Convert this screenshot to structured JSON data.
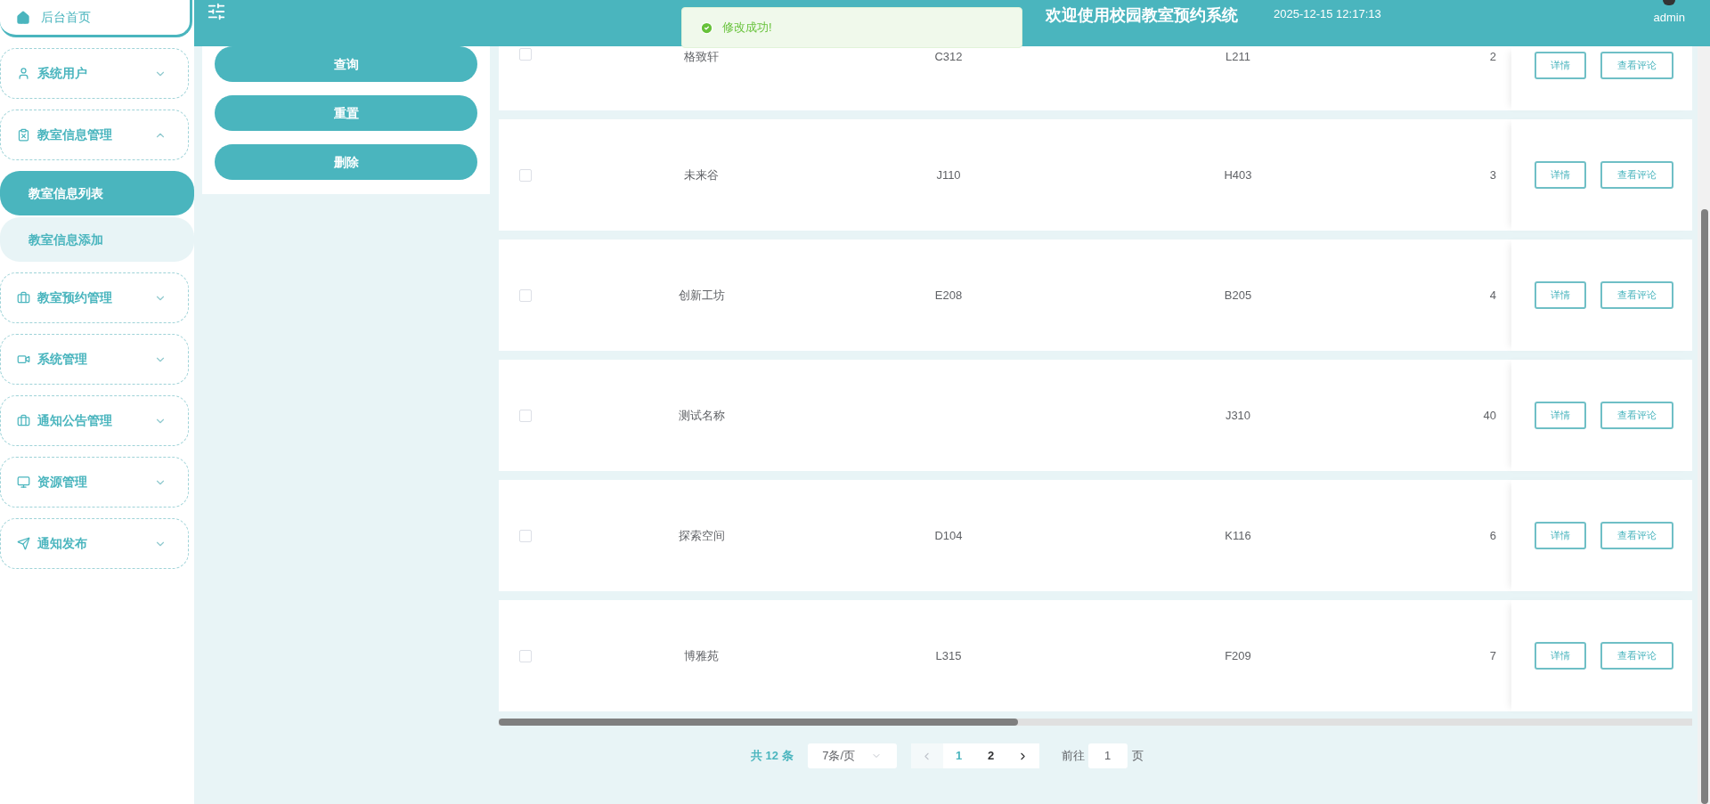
{
  "sidebar": {
    "items": [
      {
        "kind": "link",
        "label": "后台首页",
        "selected": true
      },
      {
        "kind": "group",
        "label": "系统用户",
        "expanded": false
      },
      {
        "kind": "group",
        "label": "教室信息管理",
        "expanded": true,
        "children": [
          {
            "label": "教室信息列表",
            "selected": true
          },
          {
            "label": "教室信息添加",
            "selected": false
          }
        ]
      },
      {
        "kind": "group",
        "label": "教室预约管理",
        "expanded": false
      },
      {
        "kind": "group",
        "label": "系统管理",
        "expanded": false
      },
      {
        "kind": "group",
        "label": "通知公告管理",
        "expanded": false
      },
      {
        "kind": "group",
        "label": "资源管理",
        "expanded": false
      },
      {
        "kind": "group",
        "label": "通知发布",
        "expanded": false
      }
    ]
  },
  "header": {
    "title": "欢迎使用校园教室预约系统",
    "datetime": "2025-12-15 12:17:13",
    "user": "admin"
  },
  "toast": {
    "kind": "success",
    "message": "修改成功!"
  },
  "search_panel": {
    "buttons": [
      "查询",
      "重置",
      "删除"
    ]
  },
  "table": {
    "rows": [
      {
        "checked": false,
        "cells": [
          "格致轩",
          "C312",
          "L211",
          "2"
        ],
        "actions": [
          "详情",
          "查看评论"
        ]
      },
      {
        "checked": false,
        "cells": [
          "未来谷",
          "J110",
          "H403",
          "3"
        ],
        "actions": [
          "详情",
          "查看评论"
        ]
      },
      {
        "checked": false,
        "cells": [
          "创新工坊",
          "E208",
          "B205",
          "4"
        ],
        "actions": [
          "详情",
          "查看评论"
        ]
      },
      {
        "checked": false,
        "cells": [
          "测试名称",
          "",
          "J310",
          "40"
        ],
        "actions": [
          "详情",
          "查看评论"
        ]
      },
      {
        "checked": false,
        "cells": [
          "探索空间",
          "D104",
          "K116",
          "6"
        ],
        "actions": [
          "详情",
          "查看评论"
        ]
      },
      {
        "checked": false,
        "cells": [
          "博雅苑",
          "L315",
          "F209",
          "7"
        ],
        "actions": [
          "详情",
          "查看评论"
        ]
      }
    ]
  },
  "pagination": {
    "total": "共 12 条",
    "page_size": "7条/页",
    "prev_disabled": true,
    "pages": [
      {
        "label": "1",
        "selected": true
      },
      {
        "label": "2",
        "selected": false
      }
    ],
    "goto_label": "前往",
    "goto_value": "1",
    "goto_suffix": "页"
  }
}
